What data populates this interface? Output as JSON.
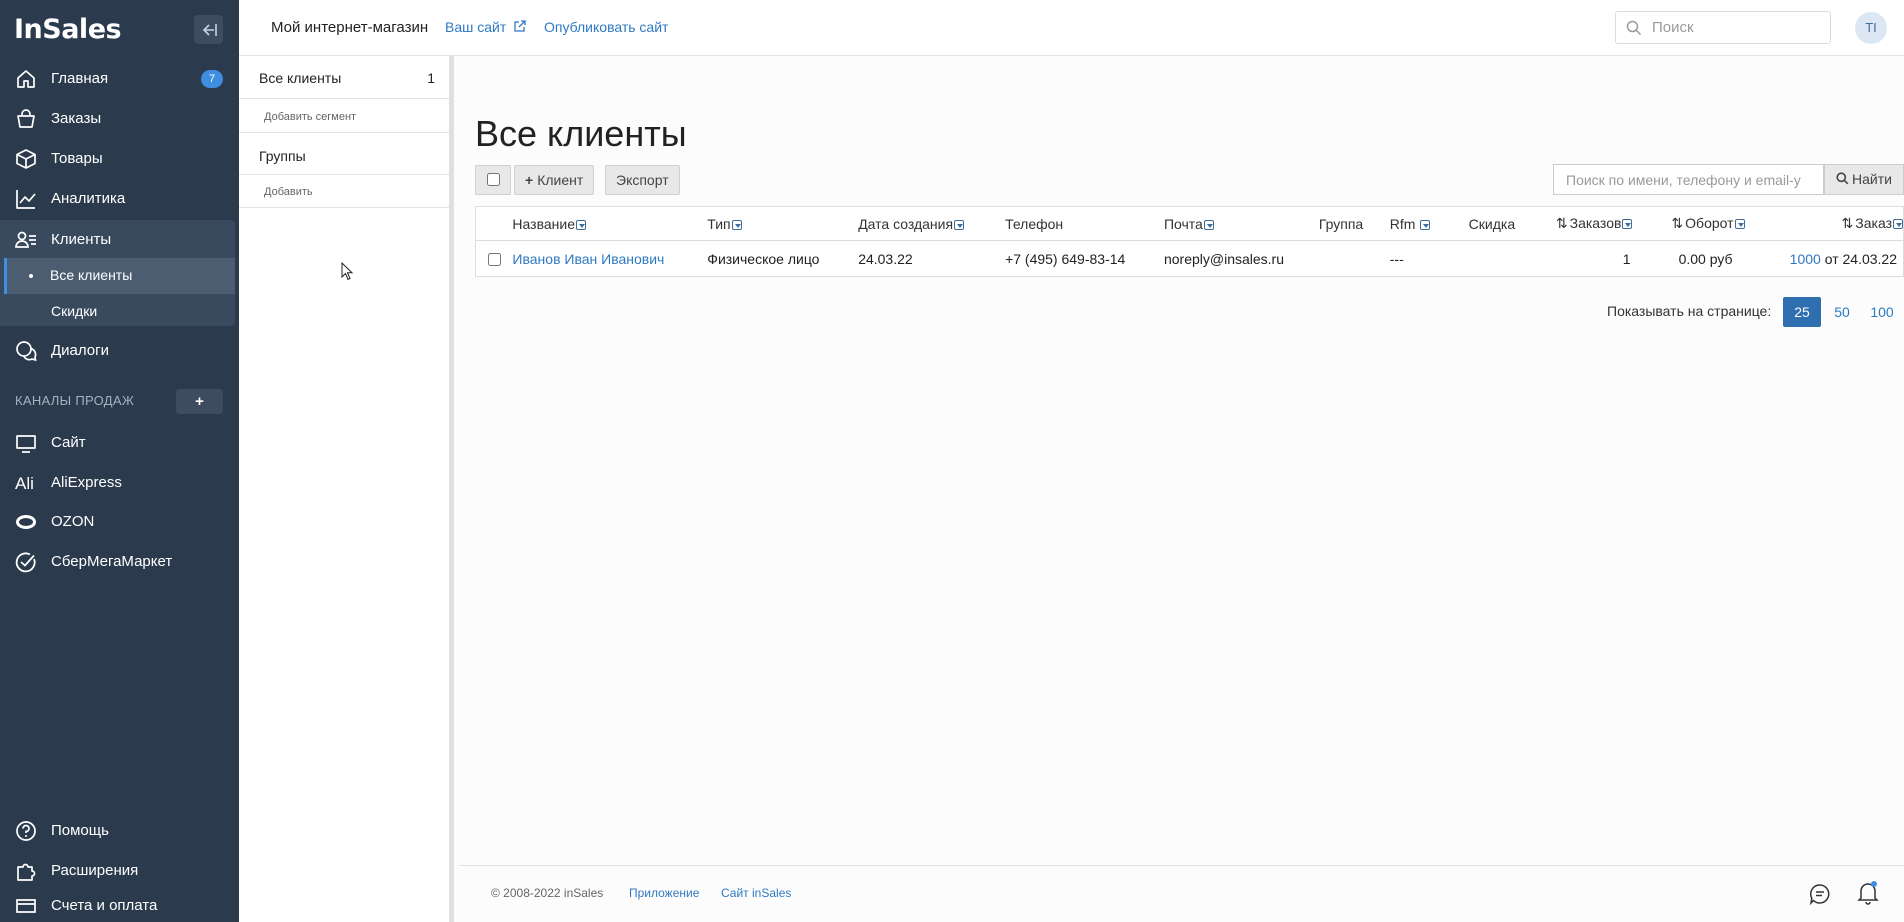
{
  "sidebar": {
    "logo": "InSales",
    "main_items": [
      {
        "label": "Главная",
        "icon": "home-icon",
        "badge": "7"
      },
      {
        "label": "Заказы",
        "icon": "bag-icon"
      },
      {
        "label": "Товары",
        "icon": "box-icon"
      },
      {
        "label": "Аналитика",
        "icon": "chart-icon"
      },
      {
        "label": "Клиенты",
        "icon": "clients-icon"
      }
    ],
    "client_sub": [
      {
        "label": "Все клиенты"
      },
      {
        "label": "Скидки"
      }
    ],
    "dialogs": {
      "label": "Диалоги",
      "icon": "chat-icon"
    },
    "channels_title": "КАНАЛЫ ПРОДАЖ",
    "channels_add": "+",
    "channels": [
      {
        "label": "Сайт",
        "icon": "monitor-icon"
      },
      {
        "label": "AliExpress",
        "icon": "aliexpress-icon"
      },
      {
        "label": "OZON",
        "icon": "ozon-icon"
      },
      {
        "label": "СберМегаМаркет",
        "icon": "sber-icon"
      }
    ],
    "bottom_items": [
      {
        "label": "Помощь",
        "icon": "help-icon"
      },
      {
        "label": "Расширения",
        "icon": "puzzle-icon"
      },
      {
        "label": "Счета и оплата",
        "icon": "card-icon"
      }
    ]
  },
  "topbar": {
    "shop_name": "Мой интернет-магазин",
    "your_site": "Ваш сайт",
    "publish": "Опубликовать сайт",
    "search_placeholder": "Поиск",
    "avatar": "TI"
  },
  "segments": {
    "all_label": "Все клиенты",
    "all_count": "1",
    "add_segment": "Добавить сегмент",
    "groups_label": "Группы",
    "add_group": "Добавить"
  },
  "main": {
    "title": "Все клиенты",
    "btn_client": "Клиент",
    "btn_export": "Экспорт",
    "search_placeholder": "Поиск по имени, телефону и email-у",
    "find_label": "Найти",
    "columns": {
      "name": "Название",
      "type": "Тип",
      "created": "Дата создания",
      "phone": "Телефон",
      "email": "Почта",
      "group": "Группа",
      "rfm": "Rfm",
      "discount": "Скидка",
      "orders": "Заказов",
      "turnover": "Оборот",
      "order": "Заказ"
    },
    "rows": [
      {
        "name": "Иванов Иван Иванович",
        "type": "Физическое лицо",
        "created": "24.03.22",
        "phone": "+7 (495) 649-83-14",
        "email": "noreply@insales.ru",
        "group": "",
        "rfm": "---",
        "discount": "",
        "orders": "1",
        "turnover": "0.00 руб",
        "order_num": "1000",
        "order_date": "от 24.03.22"
      }
    ],
    "per_page_label": "Показывать на странице:",
    "per_page": [
      "25",
      "50",
      "100"
    ],
    "per_page_active": "25"
  },
  "footer": {
    "copyright": "© 2008-2022 inSales",
    "app_link": "Приложение",
    "site_link": "Сайт inSales"
  },
  "colors": {
    "sidebar_bg": "#2b3a4d",
    "accent": "#2f79c2",
    "badge": "#3f8fe0"
  }
}
